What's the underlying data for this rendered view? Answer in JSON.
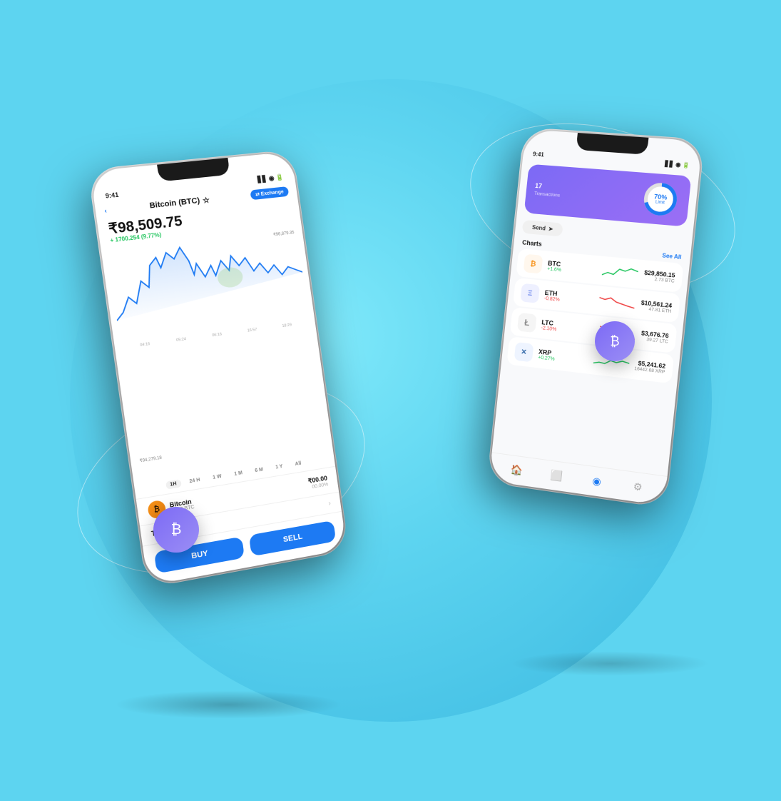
{
  "background": {
    "color": "#5dd4f0"
  },
  "phone1": {
    "time": "9:41",
    "header": {
      "back_label": "‹",
      "coin_name": "Bitcoin (BTC)",
      "star": "☆",
      "exchange_label": "⇄ Exchange"
    },
    "price": {
      "main": "₹98,509.75",
      "change": "+ 1700.254 (9.77%)"
    },
    "chart": {
      "high_label": "₹96,879.35",
      "low_label": "₹94,279.18",
      "time_labels": [
        "04:16",
        "05:24",
        "06:16",
        "16:57",
        "18:29"
      ],
      "filters": [
        "1H",
        "24 H",
        "1 W",
        "1 M",
        "6 M",
        "1 Y",
        "All"
      ]
    },
    "coin_row": {
      "name": "Bitcoin",
      "amount": "00.00 BTC",
      "value": "₹00.00",
      "pct": "00.00%"
    },
    "transactions_label": "Transactions",
    "buy_label": "BUY",
    "sell_label": "SELL"
  },
  "phone2": {
    "time": "9:41",
    "portfolio": {
      "label": "17",
      "sub_label": "Transactions",
      "donut_pct": "70%",
      "donut_text": "Limit"
    },
    "send_label": "Send",
    "charts_section": {
      "title": "Charts",
      "see_all": "See All"
    },
    "crypto_items": [
      {
        "symbol": "BTC",
        "change": "+1.6%",
        "change_dir": "up",
        "usd": "$29,850.15",
        "native": "2.73 BTC",
        "icon": "₿",
        "icon_color": "#f7931a"
      },
      {
        "symbol": "ETH",
        "change": "-0.82%",
        "change_dir": "down",
        "usd": "$10,561.24",
        "native": "47.81 ETH",
        "icon": "Ξ",
        "icon_color": "#627eea"
      },
      {
        "symbol": "LTC",
        "change": "-2.10%",
        "change_dir": "down",
        "usd": "$3,676.76",
        "native": "39.27 LTC",
        "icon": "Ł",
        "icon_color": "#bfbbbb"
      },
      {
        "symbol": "XRP",
        "change": "+0.27%",
        "change_dir": "up",
        "usd": "$5,241.62",
        "native": "16442.68 XRP",
        "icon": "✕",
        "icon_color": "#346aa9"
      }
    ],
    "nav_icons": [
      "🏠",
      "◫",
      "◉",
      "⚙"
    ]
  },
  "floating_coins": [
    {
      "id": "coin1",
      "symbol": "₿"
    },
    {
      "id": "coin2",
      "symbol": "₿"
    }
  ]
}
